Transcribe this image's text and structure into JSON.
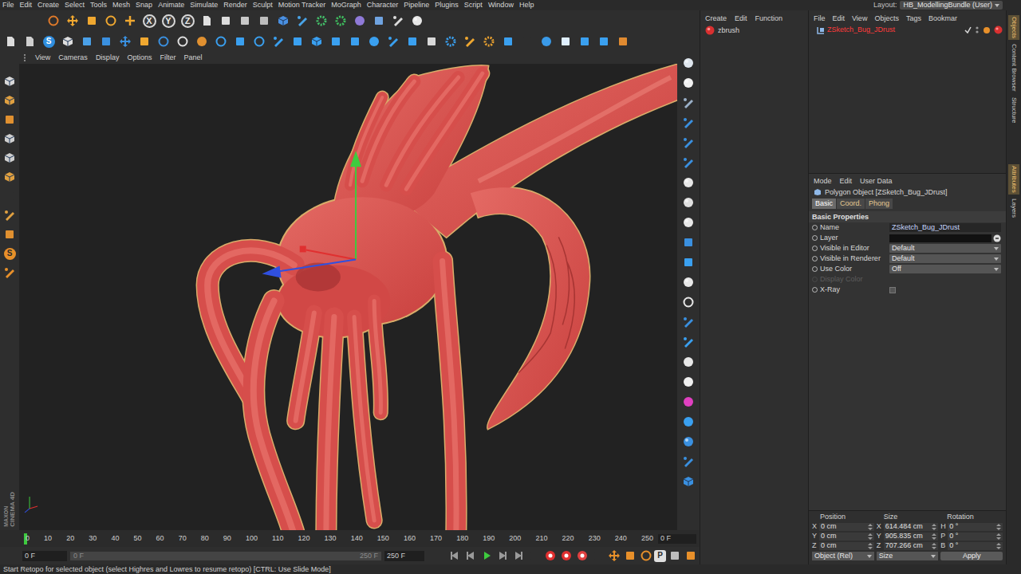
{
  "menu_bar": {
    "items": [
      "File",
      "Edit",
      "Create",
      "Select",
      "Tools",
      "Mesh",
      "Snap",
      "Animate",
      "Simulate",
      "Render",
      "Sculpt",
      "Motion Tracker",
      "MoGraph",
      "Character",
      "Pipeline",
      "Plugins",
      "Script",
      "Window",
      "Help"
    ],
    "layout_label": "Layout:",
    "layout_value": "HB_ModellingBundle (User)"
  },
  "toolbar": {
    "axis_buttons": [
      {
        "label": "X",
        "on": true
      },
      {
        "label": "Y",
        "on": true
      },
      {
        "label": "Z",
        "on": true
      }
    ],
    "snap_label": "S"
  },
  "left_strip": {
    "snap_label": "S",
    "logo_top": "MAXON",
    "logo_bottom": "CINEMA 4D"
  },
  "viewport": {
    "menu": [
      "View",
      "Cameras",
      "Display",
      "Options",
      "Filter",
      "Panel"
    ]
  },
  "content_panel": {
    "menu": [
      "Create",
      "Edit",
      "Function"
    ],
    "items": [
      {
        "name": "zbrush",
        "selected": false
      }
    ]
  },
  "object_manager": {
    "menu": [
      "File",
      "Edit",
      "View",
      "Objects",
      "Tags",
      "Bookmar"
    ],
    "objects": [
      {
        "name": "ZSketch_Bug_JDrust",
        "selected": true
      }
    ]
  },
  "attributes": {
    "menu": [
      "Mode",
      "Edit",
      "User Data"
    ],
    "title": "Polygon Object [ZSketch_Bug_JDrust]",
    "tabs": [
      {
        "label": "Basic",
        "selected": true
      },
      {
        "label": "Coord.",
        "selected": false
      },
      {
        "label": "Phong",
        "selected": false
      }
    ],
    "section": "Basic Properties",
    "rows": [
      {
        "label": "Name",
        "kind": "text",
        "value": "ZSketch_Bug_JDrust",
        "disabled": false
      },
      {
        "label": "Layer",
        "kind": "layer",
        "disabled": false
      },
      {
        "label": "Visible in Editor",
        "kind": "dropdown",
        "value": "Default",
        "disabled": false
      },
      {
        "label": "Visible in Renderer",
        "kind": "dropdown",
        "value": "Default",
        "disabled": false
      },
      {
        "label": "Use Color",
        "kind": "dropdown",
        "value": "Off",
        "disabled": false
      },
      {
        "label": "Display Color",
        "kind": "color",
        "disabled": true
      },
      {
        "label": "X-Ray",
        "kind": "checkbox",
        "checked": false,
        "disabled": false
      }
    ]
  },
  "side_tabs": {
    "top": [
      {
        "label": "Objects",
        "selected": true
      },
      {
        "label": "Content Browser",
        "selected": false
      },
      {
        "label": "Structure",
        "selected": false
      }
    ],
    "bottom": [
      {
        "label": "Attributes",
        "selected": true
      },
      {
        "label": "Layers",
        "selected": false
      }
    ]
  },
  "timeline": {
    "ticks": [
      "0",
      "10",
      "20",
      "30",
      "40",
      "50",
      "60",
      "70",
      "80",
      "90",
      "100",
      "110",
      "120",
      "130",
      "140",
      "150",
      "160",
      "170",
      "180",
      "190",
      "200",
      "210",
      "220",
      "230",
      "240",
      "250"
    ],
    "playhead_level": 0,
    "current": "0 F"
  },
  "transport": {
    "start": "0 F",
    "range_start": "0 F",
    "range_end": "250 F",
    "range_level": 1,
    "end": "250 F",
    "key_label": "P"
  },
  "coordinates": {
    "headers": [
      "Position",
      "Size",
      "Rotation"
    ],
    "rows": [
      {
        "axis": "X",
        "position": "0 cm",
        "size_axis": "X",
        "size": "614.484 cm",
        "rot_axis": "H",
        "rotation": "0 °"
      },
      {
        "axis": "Y",
        "position": "0 cm",
        "size_axis": "Y",
        "size": "905.835 cm",
        "rot_axis": "P",
        "rotation": "0 °"
      },
      {
        "axis": "Z",
        "position": "0 cm",
        "size_axis": "Z",
        "size": "707.266 cm",
        "rot_axis": "B",
        "rotation": "0 °"
      }
    ],
    "mode": "Object (Rel)",
    "size_mode": "Size",
    "apply": "Apply"
  },
  "status_bar": "Start Retopo for selected object (select Highres and Lowres to resume retopo) [CTRL: Use Slide Mode]"
}
